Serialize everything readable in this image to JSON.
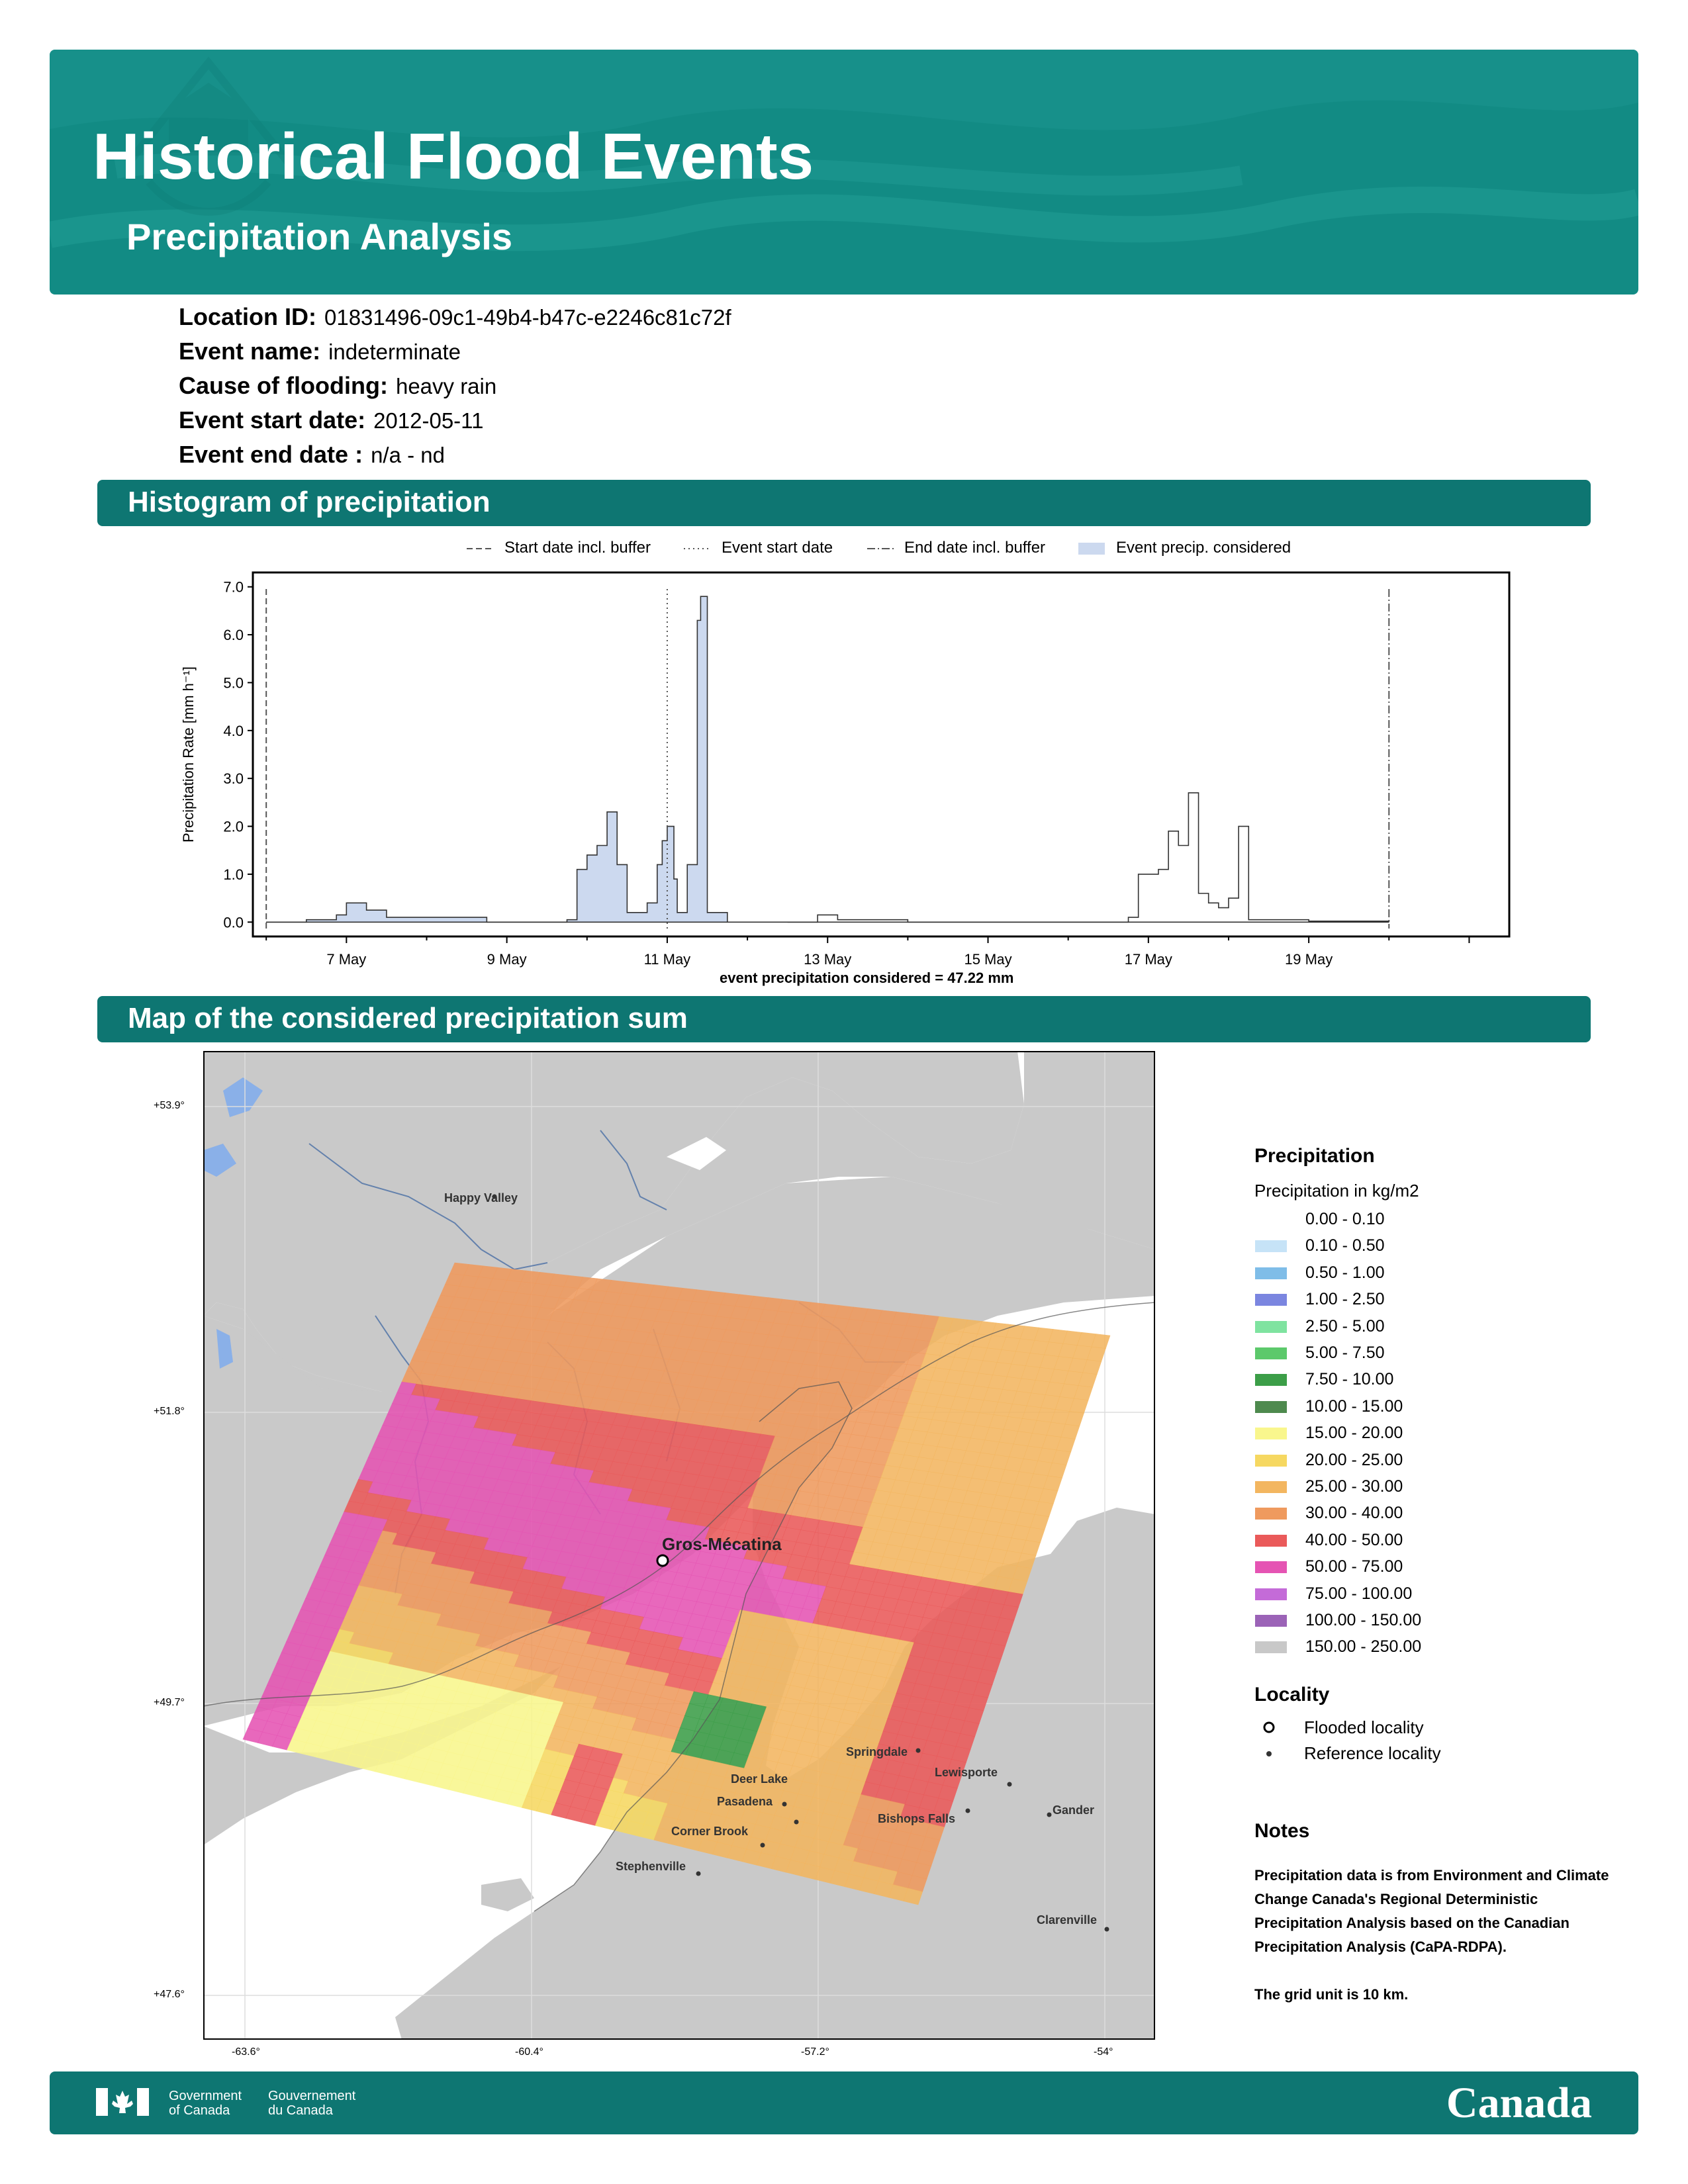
{
  "header": {
    "title": "Historical Flood Events",
    "subtitle": "Precipitation Analysis"
  },
  "event_info": [
    {
      "label": "Location ID:",
      "value": "01831496-09c1-49b4-b47c-e2246c81c72f"
    },
    {
      "label": "Event name:",
      "value": "indeterminate"
    },
    {
      "label": "Cause of flooding:",
      "value": "heavy rain"
    },
    {
      "label": "Event start date:",
      "value": "2012-05-11"
    },
    {
      "label": "Event end date :",
      "value": "n/a - nd"
    }
  ],
  "histogram_section": {
    "heading": "Histogram of precipitation",
    "legend": {
      "start_buffer": "Start date incl. buffer",
      "event_start": "Event start date",
      "end_buffer": "End date incl. buffer",
      "event_precip": "Event precip. considered"
    },
    "ylabel": "Precipitation Rate [mm h⁻¹]",
    "y_ticks": [
      "0.0",
      "1.0",
      "2.0",
      "3.0",
      "4.0",
      "5.0",
      "6.0",
      "7.0"
    ],
    "x_ticks": [
      "7 May",
      "9 May",
      "11 May",
      "13 May",
      "15 May",
      "17 May",
      "19 May"
    ],
    "caption": "event precipitation considered = 47.22 mm"
  },
  "chart_data": {
    "type": "area",
    "xlabel": "",
    "ylabel": "Precipitation Rate [mm h⁻¹]",
    "ylim": [
      -0.3,
      7.3
    ],
    "xlim_days": [
      "2012-05-05T20:00",
      "2012-05-21T12:00"
    ],
    "start_buffer_date": "2012-05-06",
    "event_start_date": "2012-05-11",
    "end_buffer_date": "2012-05-20",
    "legend_position": "top (outside)",
    "grid": false,
    "series": [
      {
        "name": "Event precip. considered",
        "points": [
          [
            "2012-05-06T00:00",
            0.0
          ],
          [
            "2012-05-06T12:00",
            0.05
          ],
          [
            "2012-05-06T21:00",
            0.15
          ],
          [
            "2012-05-07T00:00",
            0.4
          ],
          [
            "2012-05-07T06:00",
            0.25
          ],
          [
            "2012-05-07T12:00",
            0.1
          ],
          [
            "2012-05-08T06:00",
            0.1
          ],
          [
            "2012-05-08T18:00",
            0.0
          ],
          [
            "2012-05-09T12:00",
            0.0
          ],
          [
            "2012-05-09T18:00",
            0.05
          ],
          [
            "2012-05-09T21:00",
            1.1
          ],
          [
            "2012-05-10T00:00",
            1.4
          ],
          [
            "2012-05-10T03:00",
            1.6
          ],
          [
            "2012-05-10T06:00",
            2.3
          ],
          [
            "2012-05-10T09:00",
            1.2
          ],
          [
            "2012-05-10T12:00",
            0.2
          ],
          [
            "2012-05-10T18:00",
            0.4
          ],
          [
            "2012-05-10T21:00",
            1.2
          ],
          [
            "2012-05-10T22:30",
            1.7
          ],
          [
            "2012-05-11T00:00",
            2.0
          ],
          [
            "2012-05-11T02:00",
            0.9
          ],
          [
            "2012-05-11T03:00",
            0.2
          ],
          [
            "2012-05-11T06:00",
            1.2
          ],
          [
            "2012-05-11T09:00",
            6.3
          ],
          [
            "2012-05-11T10:00",
            6.8
          ],
          [
            "2012-05-11T12:00",
            0.2
          ],
          [
            "2012-05-11T18:00",
            0.0
          ]
        ]
      },
      {
        "name": "",
        "points": [
          [
            "2012-05-12T12:00",
            0.0
          ],
          [
            "2012-05-12T21:00",
            0.15
          ],
          [
            "2012-05-13T03:00",
            0.05
          ],
          [
            "2012-05-14T00:00",
            0.0
          ],
          [
            "2012-05-16T12:00",
            0.0
          ],
          [
            "2012-05-16T18:00",
            0.1
          ],
          [
            "2012-05-16T21:00",
            1.0
          ],
          [
            "2012-05-17T03:00",
            1.1
          ],
          [
            "2012-05-17T06:00",
            1.9
          ],
          [
            "2012-05-17T09:00",
            1.6
          ],
          [
            "2012-05-17T12:00",
            2.7
          ],
          [
            "2012-05-17T15:00",
            0.6
          ],
          [
            "2012-05-17T18:00",
            0.4
          ],
          [
            "2012-05-17T21:00",
            0.3
          ],
          [
            "2012-05-18T00:00",
            0.5
          ],
          [
            "2012-05-18T03:00",
            2.0
          ],
          [
            "2012-05-18T06:00",
            0.05
          ],
          [
            "2012-05-19T00:00",
            0.02
          ],
          [
            "2012-05-20T00:00",
            0.0
          ]
        ]
      }
    ]
  },
  "map_section": {
    "heading": "Map of the considered precipitation sum",
    "lat_labels": [
      "+53.9°",
      "+51.8°",
      "+49.7°",
      "+47.6°"
    ],
    "lon_labels": [
      "-63.6°",
      "-60.4°",
      "-57.2°",
      "-54°"
    ],
    "flooded_locality": "Gros-Mécatina",
    "reference_localities": [
      "Happy Valley",
      "Springdale",
      "Lewisporte",
      "Deer Lake",
      "Pasadena",
      "Bishops Falls",
      "Gander",
      "Corner Brook",
      "Stephenville",
      "Clarenville"
    ]
  },
  "map_legend": {
    "heading": "Precipitation",
    "units": "Precipitation in kg/m2",
    "classes": [
      {
        "label": "0.00 - 0.10",
        "color": "#ffffff"
      },
      {
        "label": "0.10 - 0.50",
        "color": "#c6e3f7"
      },
      {
        "label": "0.50 - 1.00",
        "color": "#7fbde8"
      },
      {
        "label": "1.00 - 2.50",
        "color": "#7b86e0"
      },
      {
        "label": "2.50 - 5.00",
        "color": "#7fe3a0"
      },
      {
        "label": "5.00 - 7.50",
        "color": "#5cc96b"
      },
      {
        "label": "7.50 - 10.00",
        "color": "#3c9e48"
      },
      {
        "label": "10.00 - 15.00",
        "color": "#4e8a4e"
      },
      {
        "label": "15.00 - 20.00",
        "color": "#f9f68d"
      },
      {
        "label": "20.00 - 25.00",
        "color": "#f6d861"
      },
      {
        "label": "25.00 - 30.00",
        "color": "#f3b660"
      },
      {
        "label": "30.00 - 40.00",
        "color": "#ef9a5e"
      },
      {
        "label": "40.00 - 50.00",
        "color": "#ea5a5a"
      },
      {
        "label": "50.00 - 75.00",
        "color": "#e554b3"
      },
      {
        "label": "75.00 - 100.00",
        "color": "#c46bd8"
      },
      {
        "label": "100.00 - 150.00",
        "color": "#9b63b7"
      },
      {
        "label": "150.00 - 250.00",
        "color": "#c8c8c8"
      }
    ],
    "locality_heading": "Locality",
    "flooded_label": "Flooded locality",
    "reference_label": "Reference locality"
  },
  "notes": {
    "heading": "Notes",
    "text": "Precipitation data is from Environment and Climate Change Canada's Regional Deterministic Precipitation Analysis based on the Canadian Precipitation Analysis (CaPA-RDPA).",
    "grid_unit": "The grid unit is 10 km."
  },
  "footer": {
    "gov_en": "Government\nof Canada",
    "gov_fr": "Gouvernement\ndu Canada",
    "wordmark": "Canada"
  },
  "colors": {
    "banner": "#128b84",
    "section_bar": "#0e7672",
    "histogram_fill": "#ccd9ef"
  }
}
